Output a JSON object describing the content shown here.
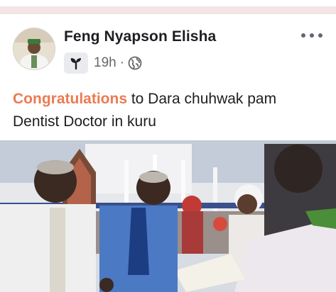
{
  "post": {
    "author": "Feng Nyapson Elisha",
    "time": "19h",
    "separator": "·",
    "text_highlight": "Congratulations",
    "text_rest": " to Dara chuhwak pam Dentist Doctor in kuru"
  },
  "colors": {
    "highlight": "#ec7a53",
    "name": "#1c1e21",
    "meta": "#65676b"
  },
  "icons": {
    "badge": "sprout-icon",
    "audience": "globe-icon",
    "menu": "more-options-icon"
  }
}
